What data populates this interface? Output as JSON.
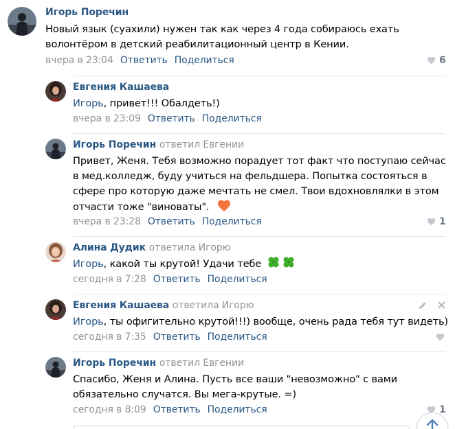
{
  "colors": {
    "link": "#2a5885",
    "muted": "#939393",
    "divider": "#e7e8ec",
    "heart_empty": "#c5c9cf"
  },
  "comments": [
    {
      "author": "Игорь Поречин",
      "replied": "",
      "text_lines": [
        "Новый язык (суахили) нужен так как через 4 года собираюсь ехать",
        "волонтёром в детский реабилитационный центр в Кении."
      ],
      "time": "вчера в 23:04",
      "reply": "Ответить",
      "share": "Поделиться",
      "likes": "6"
    },
    {
      "author": "Евгения Кашаева",
      "replied": "",
      "mention": "Игорь",
      "text_rest": ", привет!!! Обалдеть!)",
      "time": "вчера в 23:09",
      "reply": "Ответить",
      "share": "Поделиться"
    },
    {
      "author": "Игорь Поречин",
      "replied": "ответил Евгении",
      "text_lines": [
        "Привет, Женя. Тебя возможно порадует тот факт что поступаю сейчас",
        "в мед.колледж, буду учиться на фельдшера. Попытка состояться в",
        "сфере про которую даже мечтать не смел. Твои вдохновлялки в этом",
        "отчасти тоже \"виноваты\"."
      ],
      "emoji": "orange-heart-emoji",
      "time": "вчера в 23:28",
      "reply": "Ответить",
      "share": "Поделиться",
      "likes": "1"
    },
    {
      "author": "Алина Дудик",
      "replied": "ответила Игорю",
      "mention": "Игорь",
      "text_rest": ", какой ты крутой! Удачи тебе",
      "emoji": "four-leaf-clover-emoji",
      "time": "сегодня в 7:28",
      "reply": "Ответить",
      "share": "Поделиться"
    },
    {
      "author": "Евгения Кашаева",
      "replied": "ответила Игорю",
      "mention": "Игорь",
      "text_rest": ", ты офигительно крутой!!!) вообще, очень рада тебя тут видеть)",
      "time": "сегодня в 7:35",
      "reply": "Ответить",
      "share": "Поделиться"
    },
    {
      "author": "Игорь Поречин",
      "replied": "ответил Евгении",
      "text_lines": [
        "Спасибо, Женя и Алина. Пусть все ваши \"невозможно\" с вами",
        "обязательно случатся. Вы мега-крутые. =)"
      ],
      "time": "сегодня в 8:09",
      "reply": "Ответить",
      "share": "Поделиться",
      "likes": "1"
    }
  ]
}
